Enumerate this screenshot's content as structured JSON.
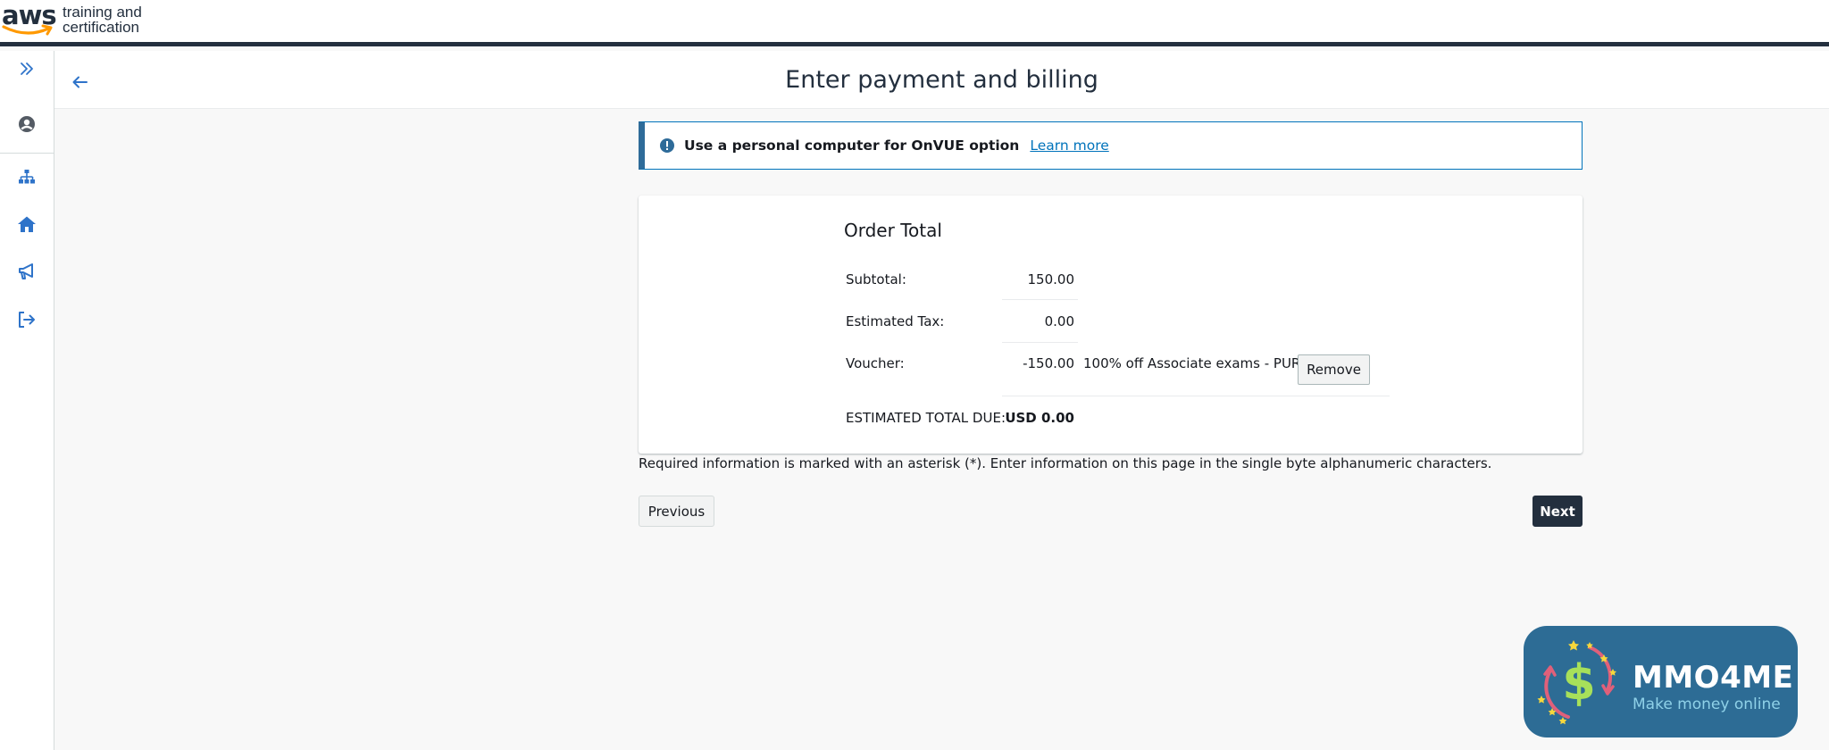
{
  "brand": {
    "logo_word": "aws",
    "logo_line1": "training and",
    "logo_line2": "certification"
  },
  "rail": {
    "items": [
      {
        "icon": "chevrons-right-icon"
      },
      {
        "icon": "user-circle-icon"
      },
      {
        "icon": "sitemap-icon"
      },
      {
        "icon": "home-icon"
      },
      {
        "icon": "megaphone-icon"
      },
      {
        "icon": "sign-out-icon"
      }
    ],
    "accent": "#2e73c9"
  },
  "header": {
    "title": "Enter payment and billing"
  },
  "banner": {
    "text": "Use a personal computer for OnVUE option",
    "link": "Learn more"
  },
  "order": {
    "title": "Order Total",
    "subtotal_label": "Subtotal:",
    "subtotal_value": "150.00",
    "tax_label": "Estimated Tax:",
    "tax_value": "0.00",
    "voucher_label": "Voucher:",
    "voucher_value": "-150.00",
    "voucher_desc": "100% off Associate exams - PUR",
    "remove_label": "Remove",
    "total_label": "ESTIMATED TOTAL DUE:",
    "total_value": "USD 0.00"
  },
  "footer": {
    "note": "Required information is marked with an asterisk (*). Enter information on this page in the single byte alphanumeric characters.",
    "previous_label": "Previous",
    "next_label": "Next"
  },
  "watermark": {
    "brand": "MMO4ME",
    "tagline": "Make money online"
  },
  "colors": {
    "nav_dark": "#232f3e",
    "link": "#0073bb",
    "aws_orange": "#ff9900",
    "watermark_bg": "#2d6c95"
  }
}
